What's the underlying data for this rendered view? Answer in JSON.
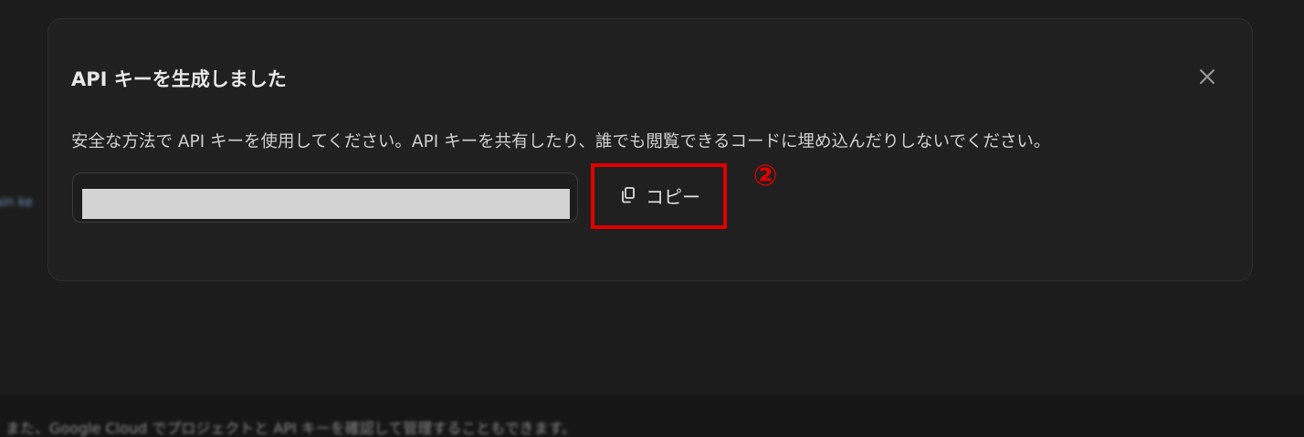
{
  "background": {
    "left_fragment": "ain ke",
    "footer_text": "、また、Google Cloud でプロジェクトと API キーを確認して管理することもできます。"
  },
  "dialog": {
    "title": "API キーを生成しました",
    "description": "安全な方法で API キーを使用してください。API キーを共有したり、誰でも閲覧できるコードに埋め込んだりしないでください。",
    "key_value": "",
    "copy_label": "コピー",
    "close_icon": "close-icon",
    "copy_icon": "copy-icon"
  },
  "annotation": {
    "step_marker": "②",
    "color": "#e00000"
  }
}
